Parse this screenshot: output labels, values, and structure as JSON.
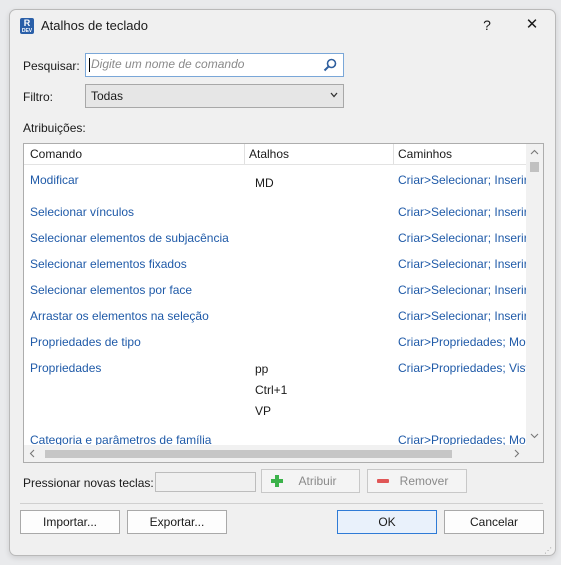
{
  "window": {
    "title": "Atalhos de teclado",
    "help": "?",
    "close": "✕",
    "app_icon_letter": "R",
    "app_icon_sub": "DEV"
  },
  "search": {
    "label": "Pesquisar:",
    "placeholder": "Digite um nome de comando",
    "value": ""
  },
  "filter": {
    "label": "Filtro:",
    "selected": "Todas"
  },
  "assignments_label": "Atribuições:",
  "columns": {
    "command": "Comando",
    "shortcuts": "Atalhos",
    "paths": "Caminhos"
  },
  "rows": [
    {
      "command": "Modificar",
      "shortcuts": [
        "MD"
      ],
      "path": "Criar>Selecionar; Inserir"
    },
    {
      "command": "Selecionar vínculos",
      "shortcuts": [],
      "path": "Criar>Selecionar; Inserir"
    },
    {
      "command": "Selecionar elementos de subjacência",
      "shortcuts": [],
      "path": "Criar>Selecionar; Inserir"
    },
    {
      "command": "Selecionar elementos fixados",
      "shortcuts": [],
      "path": "Criar>Selecionar; Inserir"
    },
    {
      "command": "Selecionar elementos por face",
      "shortcuts": [],
      "path": "Criar>Selecionar; Inserir"
    },
    {
      "command": "Arrastar os elementos na seleção",
      "shortcuts": [],
      "path": "Criar>Selecionar; Inserir"
    },
    {
      "command": "Propriedades de tipo",
      "shortcuts": [],
      "path": "Criar>Propriedades; Mo"
    },
    {
      "command": "Propriedades",
      "shortcuts": [
        "pp",
        "Ctrl+1",
        "VP"
      ],
      "path": "Criar>Propriedades; Vist"
    },
    {
      "command": "Categoria e parâmetros de família",
      "shortcuts": [],
      "path": "Criar>Propriedades; Mo"
    }
  ],
  "press_keys": {
    "label": "Pressionar novas teclas:",
    "value": ""
  },
  "buttons": {
    "assign": "Atribuir",
    "remove": "Remover",
    "import": "Importar...",
    "export": "Exportar...",
    "ok": "OK",
    "cancel": "Cancelar"
  },
  "colors": {
    "link_blue": "#1f5aa8",
    "accent": "#2f7bd6",
    "assign_icon": "#3bb24a",
    "remove_icon": "#e05656"
  }
}
